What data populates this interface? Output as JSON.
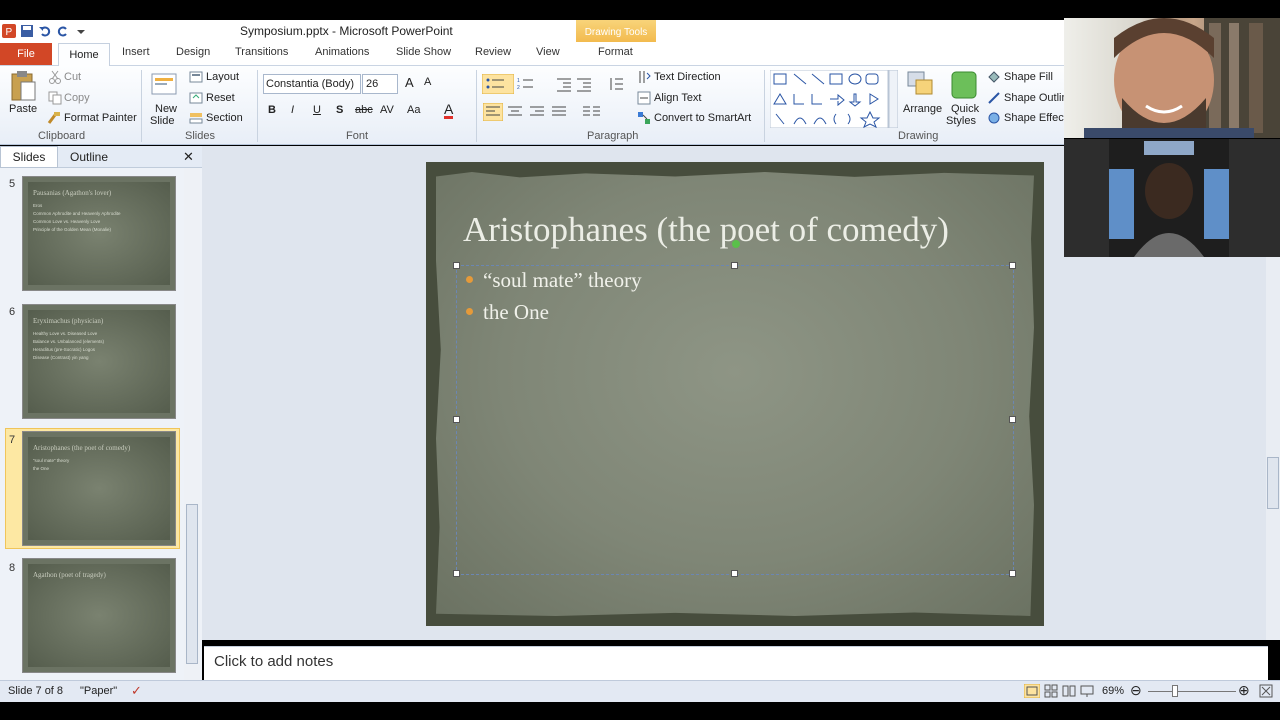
{
  "window": {
    "title": "Symposium.pptx - Microsoft PowerPoint",
    "context_tab_group": "Drawing Tools"
  },
  "tabs": [
    "File",
    "Home",
    "Insert",
    "Design",
    "Transitions",
    "Animations",
    "Slide Show",
    "Review",
    "View",
    "Format"
  ],
  "ribbon": {
    "clipboard": {
      "paste": "Paste",
      "cut": "Cut",
      "copy": "Copy",
      "format_painter": "Format Painter",
      "label": "Clipboard"
    },
    "slides": {
      "new_slide": "New",
      "new_slide2": "Slide",
      "layout": "Layout",
      "reset": "Reset",
      "section": "Section",
      "label": "Slides"
    },
    "font": {
      "name": "Constantia (Body)",
      "size": "26",
      "label": "Font"
    },
    "paragraph": {
      "text_direction": "Text Direction",
      "align_text": "Align Text",
      "convert_smartart": "Convert to SmartArt",
      "label": "Paragraph"
    },
    "drawing": {
      "arrange": "Arrange",
      "quick_styles": "Quick",
      "quick_styles2": "Styles",
      "shape_fill": "Shape Fill",
      "shape_outline": "Shape Outline",
      "shape_effects": "Shape Effects",
      "label": "Drawing"
    }
  },
  "panel": {
    "tab_slides": "Slides",
    "tab_outline": "Outline"
  },
  "thumbnails": [
    {
      "num": "5",
      "title": "Pausanias (Agathon's lover)",
      "lines": [
        "Eros",
        "Common Aphrodite and Heavenly Aphrodite",
        "Common Love vs. Heavenly Love",
        "Principle of the Golden Mean (Monalie)"
      ]
    },
    {
      "num": "6",
      "title": "Eryximachus (physician)",
      "lines": [
        "Healthy Love vs. Diseased Love",
        "Balance vs. Unbalanced (elements)",
        "Heraclitus (pre-Socratic) Logos",
        "Disease (Contrast) yin yang"
      ]
    },
    {
      "num": "7",
      "title": "Aristophanes (the poet of comedy)",
      "lines": [
        "“soul mate” theory",
        "the One"
      ]
    },
    {
      "num": "8",
      "title": "Agathon (poet of tragedy)",
      "lines": []
    }
  ],
  "slide": {
    "title": "Aristophanes (the poet of comedy)",
    "bullets": [
      "“soul mate” theory",
      "the One"
    ]
  },
  "notes_placeholder": "Click to add notes",
  "status": {
    "slide": "Slide 7 of 8",
    "theme": "\"Paper\"",
    "zoom": "69%"
  }
}
